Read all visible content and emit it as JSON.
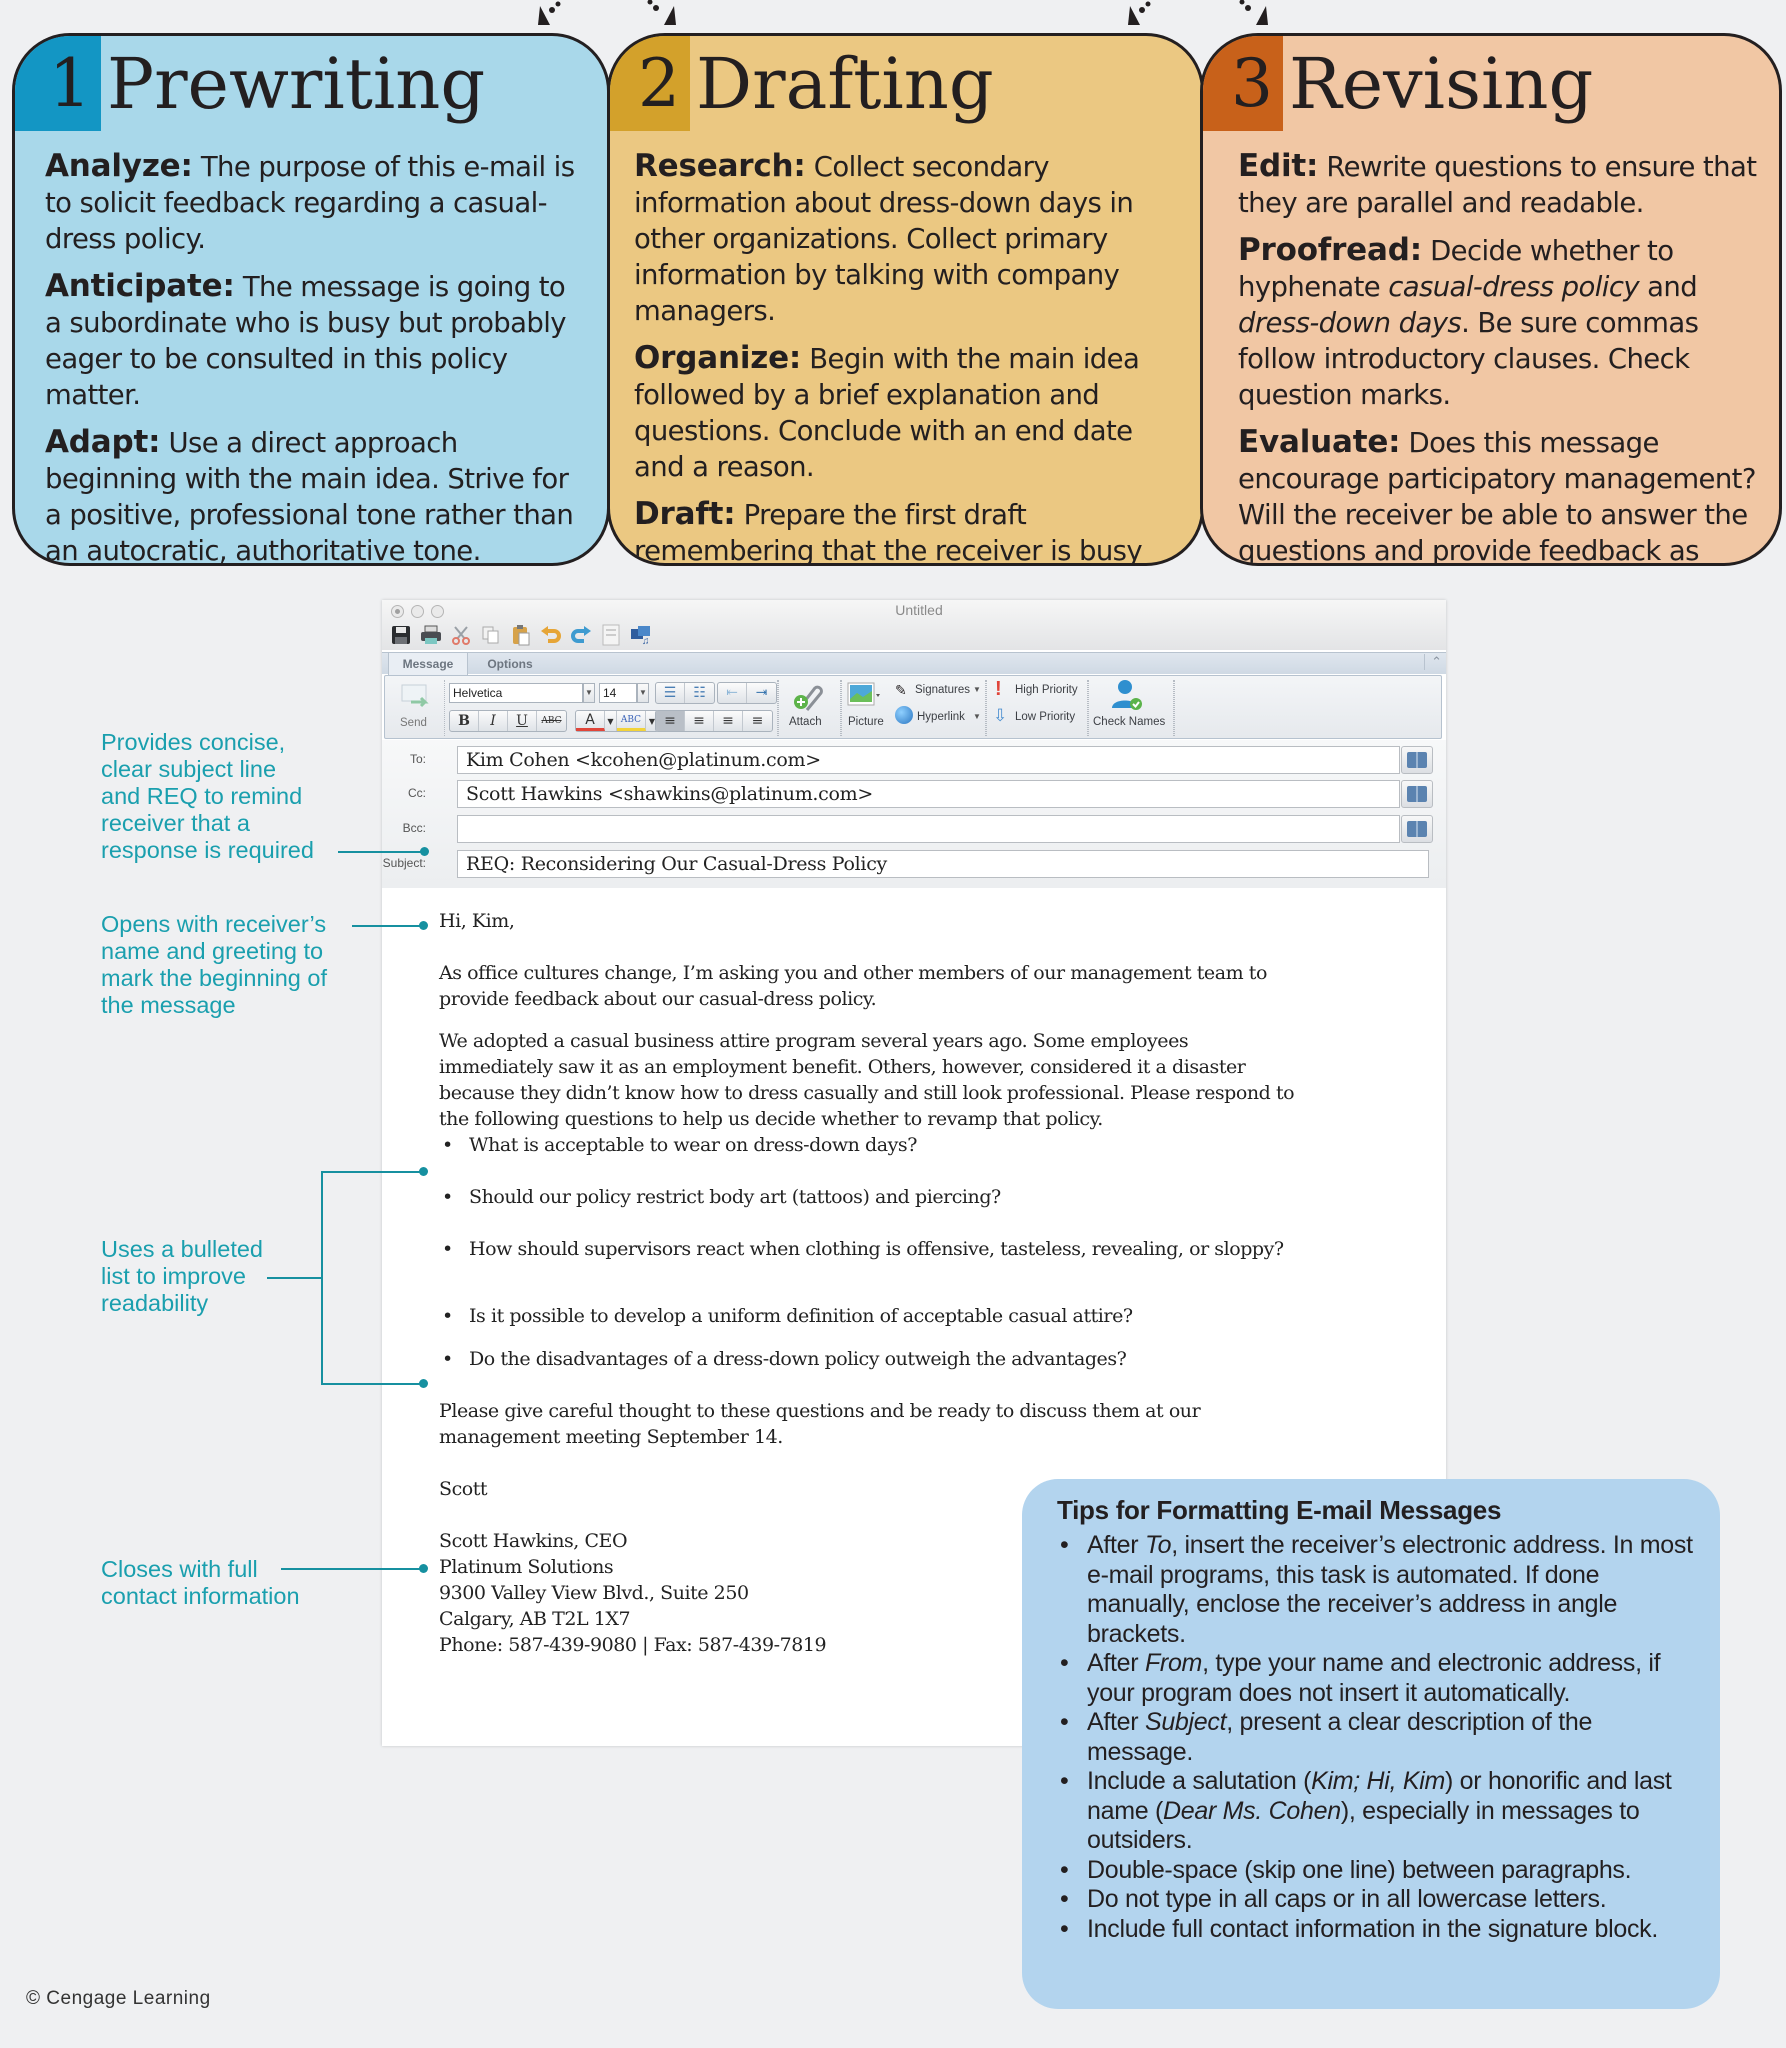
{
  "stages": [
    {
      "number": "1",
      "title": "Prewriting",
      "color": "#1396c4",
      "background": "#a9d8ea",
      "items": [
        {
          "term": "Analyze:",
          "text": " The purpose of this e-mail is to solicit feedback regarding a casual-dress policy."
        },
        {
          "term": "Anticipate:",
          "text": " The message is going to a subordinate who is busy but probably eager to be consulted in this policy matter."
        },
        {
          "term": "Adapt:",
          "text": " Use a direct approach beginning with the main idea. Strive for a positive, professional tone rather than an autocratic, authoritative tone."
        }
      ]
    },
    {
      "number": "2",
      "title": "Drafting",
      "color": "#d3a12b",
      "background": "#ebc882",
      "items": [
        {
          "term": "Research:",
          "text": " Collect secondary information about dress-down days in other organizations. Collect primary information by talking with company managers."
        },
        {
          "term": "Organize:",
          "text": " Begin with the main idea followed by a brief explanation and questions. Conclude with an end date and a reason."
        },
        {
          "term": "Draft:",
          "text": " Prepare the first draft remembering that the receiver is busy and appreciates brevity."
        }
      ]
    },
    {
      "number": "3",
      "title": "Revising",
      "color": "#c8611a",
      "background": "#f1c7a4",
      "items": [
        {
          "term": "Edit:",
          "text": " Rewrite questions to ensure that they are parallel and readable."
        },
        {
          "term": "Proofread:",
          "text_parts": [
            " Decide whether to hyphenate ",
            "casual-dress policy",
            " and ",
            "dress-down days",
            ". Be sure commas follow introductory clauses. Check question marks."
          ]
        },
        {
          "term": "Evaluate:",
          "text": " Does this message encourage participatory management? Will the receiver be able to answer the questions and provide feedback as requested?"
        }
      ]
    }
  ],
  "email_window": {
    "title": "Untitled",
    "quick_toolbar_icons": [
      "save-icon",
      "print-icon",
      "cut-icon",
      "copy-icon",
      "paste-icon",
      "undo-icon",
      "redo-icon",
      "template-icon",
      "media-browser-icon"
    ],
    "tabs": [
      {
        "label": "Message",
        "active": true
      },
      {
        "label": "Options",
        "active": false
      }
    ],
    "ribbon": {
      "send_label": "Send",
      "font_name": "Helvetica",
      "font_size": "14",
      "bold": "B",
      "italic": "I",
      "underline": "U",
      "strikethrough": "ABC",
      "font_color": "A",
      "highlight": "ABC",
      "attach_label": "Attach",
      "picture_label": "Picture",
      "signatures_label": "Signatures",
      "hyperlink_label": "Hyperlink",
      "high_priority_label": "High Priority",
      "low_priority_label": "Low Priority",
      "check_names_label": "Check Names"
    },
    "fields": {
      "to_label": "To:",
      "to_value": "Kim Cohen <kcohen@platinum.com>",
      "cc_label": "Cc:",
      "cc_value": "Scott Hawkins <shawkins@platinum.com>",
      "bcc_label": "Bcc:",
      "bcc_value": "",
      "subject_label": "Subject:",
      "subject_value": "REQ: Reconsidering Our Casual-Dress Policy"
    },
    "body": {
      "greeting": "Hi, Kim,",
      "paragraph_1_line_1": "As office cultures change, I’m asking you and other members of our management team to",
      "paragraph_1_line_2": "provide feedback about our casual-dress policy.",
      "paragraph_2_lines": [
        "We adopted a casual business attire program several years ago. Some employees",
        "immediately saw it as an employment benefit. Others, however, considered it a disaster",
        "because they didn’t know how to dress casually and still look professional. Please respond to",
        "the following questions to help us decide whether to revamp that policy."
      ],
      "bullets": [
        "What is acceptable to wear on dress-down days?",
        "Should our policy restrict body art (tattoos) and piercing?",
        "How should supervisors react when clothing is offensive, tasteless, revealing, or sloppy?",
        "Is it possible to develop a uniform definition of acceptable casual attire?",
        "Do the disadvantages of a dress-down policy outweigh the advantages?"
      ],
      "closing_lines": [
        "Please give careful thought to these questions and be ready to discuss them at our",
        "management meeting September 14."
      ],
      "sign_off": "Scott",
      "signature": [
        "Scott Hawkins, CEO",
        "Platinum Solutions",
        "9300 Valley View Blvd., Suite 250",
        "Calgary, AB  T2L 1X7",
        "Phone: 587-439-9080 | Fax: 587-439-7819"
      ]
    }
  },
  "annotations": {
    "subject": [
      "Provides concise,",
      "clear subject line",
      "and REQ to remind",
      "receiver that a",
      "response is required"
    ],
    "greeting": [
      "Opens with receiver’s",
      "name and greeting to",
      "mark the beginning of",
      "the message"
    ],
    "bullets": [
      "Uses a bulleted",
      "list to improve",
      "readability"
    ],
    "closing": [
      "Closes with full",
      "contact information"
    ],
    "color": "#1a9fae"
  },
  "tips": {
    "title": "Tips for Formatting E-mail Messages",
    "items": [
      [
        "After ",
        "To",
        ", insert the receiver’s electronic address. In most e-mail programs, this task is automated. If done manually, enclose the receiver’s address in angle brackets."
      ],
      [
        "After ",
        "From",
        ", type your name and electronic address, if your program does not insert it automatically."
      ],
      [
        "After ",
        "Subject",
        ", present a clear description of the message."
      ],
      [
        "Include a salutation (",
        "Kim; Hi, Kim",
        ") or honorific and last name (",
        "Dear Ms. Cohen",
        "), especially in messages to outsiders."
      ],
      [
        "Double-space (skip one line) between paragraphs."
      ],
      [
        "Do not type in all caps or in all lowercase letters."
      ],
      [
        "Include full contact information in the signature block."
      ]
    ]
  },
  "copyright": "© Cengage Learning"
}
